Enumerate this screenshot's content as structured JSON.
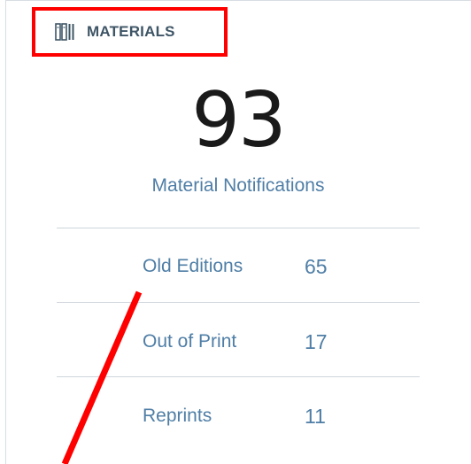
{
  "panel": {
    "title": "MATERIALS",
    "icon": "books-icon",
    "total": "93",
    "total_label": "Material Notifications",
    "rows": [
      {
        "label": "Old Editions",
        "value": "65"
      },
      {
        "label": "Out of Print",
        "value": "17"
      },
      {
        "label": "Reprints",
        "value": "11"
      }
    ]
  },
  "annotation": {
    "color": "#ff0000"
  },
  "colors": {
    "accent_text": "#4f7ea6",
    "header_text": "#3e5566",
    "divider": "#cfd6dc"
  }
}
